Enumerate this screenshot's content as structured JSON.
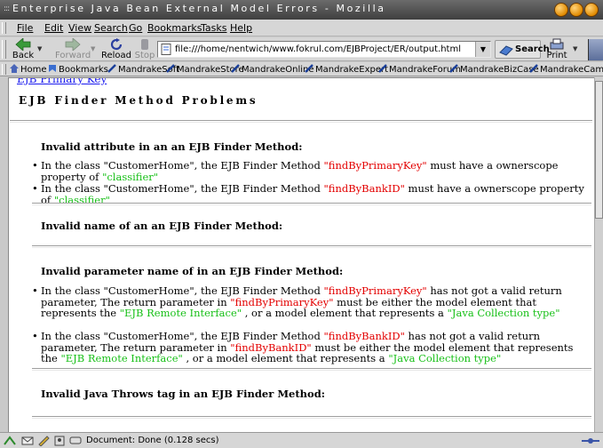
{
  "window": {
    "title": "Enterprise Java Bean External Model Errors - Mozilla"
  },
  "menu": [
    "File",
    "Edit",
    "View",
    "Search",
    "Go",
    "Bookmarks",
    "Tasks",
    "Help"
  ],
  "nav": {
    "back": "Back",
    "forward": "Forward",
    "reload": "Reload",
    "stop": "Stop",
    "url": "file:///home/nentwich/www.fokrul.com/EJBProject/ER/output.html",
    "search": "Search",
    "print": "Print"
  },
  "bookmarks": [
    "Home",
    "Bookmarks",
    "MandrakeSoft",
    "MandrakeStore",
    "MandrakeOnline",
    "MandrakeExpert",
    "MandrakeForum",
    "MandrakeBizCase",
    "MandrakeCampus"
  ],
  "page": {
    "cut_link": "EJB Primary Key",
    "heading": "EJB Finder Method Problems",
    "sections": [
      {
        "title": "Invalid attribute in an an  EJB Finder Method:",
        "items": [
          [
            {
              "t": "In the class \"CustomerHome\", the EJB Finder Method ",
              "c": ""
            },
            {
              "t": "\"findByPrimaryKey\"",
              "c": "red"
            },
            {
              "t": " must have a ownerscope property of ",
              "c": ""
            },
            {
              "t": "\"classifier\"",
              "c": "grn"
            }
          ],
          [
            {
              "t": "In the class \"CustomerHome\", the EJB Finder Method ",
              "c": ""
            },
            {
              "t": "\"findByBankID\"",
              "c": "red"
            },
            {
              "t": " must have a ownerscope property of ",
              "c": ""
            },
            {
              "t": "\"classifier\"",
              "c": "grn"
            }
          ]
        ]
      },
      {
        "title": "Invalid name of an an  EJB Finder Method:",
        "items": []
      },
      {
        "title": "Invalid parameter name of in an  EJB Finder Method:",
        "items": [
          [
            {
              "t": "In the class \"CustomerHome\", the EJB Finder Method ",
              "c": ""
            },
            {
              "t": "\"findByPrimaryKey\"",
              "c": "red"
            },
            {
              "t": " has not got a valid return parameter, The return parameter in ",
              "c": ""
            },
            {
              "t": "\"findByPrimaryKey\"",
              "c": "red"
            },
            {
              "t": " must be either the model element that represents the ",
              "c": ""
            },
            {
              "t": "\"EJB Remote Interface\"",
              "c": "grn"
            },
            {
              "t": " , or a model element that represents a ",
              "c": ""
            },
            {
              "t": "\"Java Collection type\"",
              "c": "grn"
            }
          ],
          [
            {
              "t": "In the class \"CustomerHome\", the EJB Finder Method ",
              "c": ""
            },
            {
              "t": "\"findByBankID\"",
              "c": "red"
            },
            {
              "t": " has not got a valid return parameter, The return parameter in ",
              "c": ""
            },
            {
              "t": "\"findByBankID\"",
              "c": "red"
            },
            {
              "t": " must be either the model element that represents the ",
              "c": ""
            },
            {
              "t": "\"EJB Remote Interface\"",
              "c": "grn"
            },
            {
              "t": " , or a model element that represents a ",
              "c": ""
            },
            {
              "t": "\"Java Collection type\"",
              "c": "grn"
            }
          ]
        ]
      },
      {
        "title": "Invalid Java Throws tag in an  EJB Finder Method:",
        "items": []
      }
    ]
  },
  "status": {
    "text": "Document: Done (0.128 secs)"
  },
  "colors": {
    "error_red": "#e30000",
    "value_green": "#18c018",
    "link_blue": "#1a1aee",
    "chrome": "#d6d6d6"
  },
  "icons": [
    "back-arrow-icon",
    "forward-arrow-icon",
    "reload-icon",
    "stop-icon",
    "page-icon",
    "search-icon",
    "print-icon",
    "home-icon",
    "bookmark-icon",
    "mandrake-star-icon",
    "navigator-icon",
    "mail-icon",
    "composer-icon",
    "address-book-icon",
    "irc-icon",
    "security-icon"
  ]
}
